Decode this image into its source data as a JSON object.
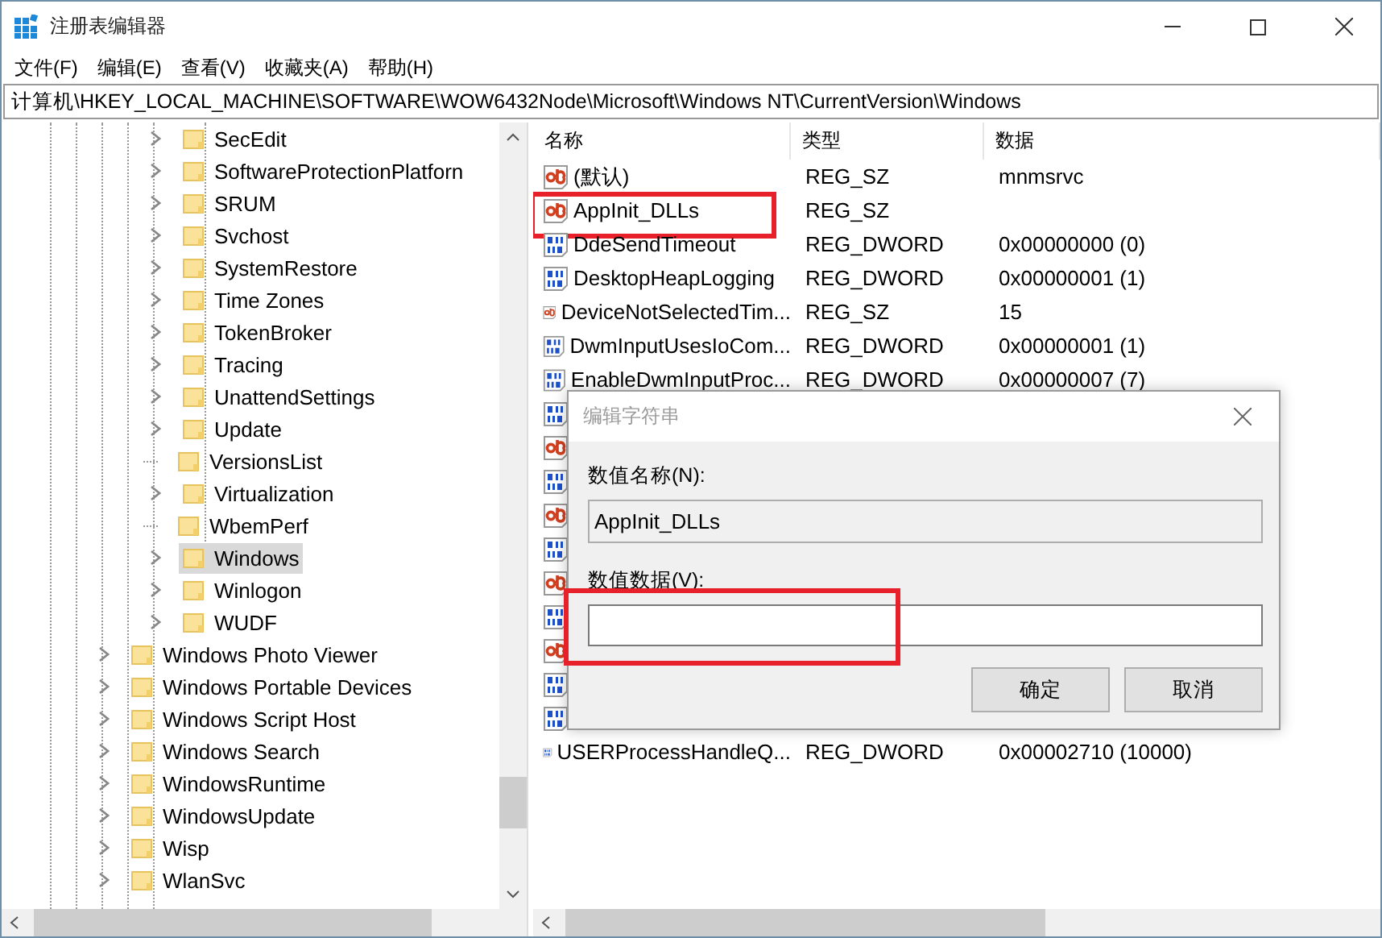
{
  "window": {
    "title": "注册表编辑器"
  },
  "menu": [
    "文件(F)",
    "编辑(E)",
    "查看(V)",
    "收藏夹(A)",
    "帮助(H)"
  ],
  "address": "计算机\\HKEY_LOCAL_MACHINE\\SOFTWARE\\WOW6432Node\\Microsoft\\Windows NT\\CurrentVersion\\Windows",
  "tree": {
    "items": [
      {
        "children": [
          {
            "name": "SecEdit",
            "expandable": true,
            "selected": false
          },
          {
            "name": "SoftwareProtectionPlatforn",
            "expandable": true,
            "selected": false
          },
          {
            "name": "SRUM",
            "expandable": true,
            "selected": false
          },
          {
            "name": "Svchost",
            "expandable": true,
            "selected": false
          },
          {
            "name": "SystemRestore",
            "expandable": true,
            "selected": false
          },
          {
            "name": "Time Zones",
            "expandable": true,
            "selected": false
          },
          {
            "name": "TokenBroker",
            "expandable": true,
            "selected": false
          },
          {
            "name": "Tracing",
            "expandable": true,
            "selected": false
          },
          {
            "name": "UnattendSettings",
            "expandable": true,
            "selected": false
          },
          {
            "name": "Update",
            "expandable": true,
            "selected": false
          },
          {
            "name": "VersionsList",
            "expandable": false,
            "selected": false
          },
          {
            "name": "Virtualization",
            "expandable": true,
            "selected": false
          },
          {
            "name": "WbemPerf",
            "expandable": false,
            "selected": false
          },
          {
            "name": "Windows",
            "expandable": true,
            "selected": true
          },
          {
            "name": "Winlogon",
            "expandable": true,
            "selected": false
          },
          {
            "name": "WUDF",
            "expandable": true,
            "selected": false
          }
        ]
      },
      {
        "name": "Windows Photo Viewer",
        "expandable": true,
        "selected": false
      },
      {
        "name": "Windows Portable Devices",
        "expandable": true,
        "selected": false
      },
      {
        "name": "Windows Script Host",
        "expandable": true,
        "selected": false
      },
      {
        "name": "Windows Search",
        "expandable": true,
        "selected": false
      },
      {
        "name": "WindowsRuntime",
        "expandable": true,
        "selected": false
      },
      {
        "name": "WindowsUpdate",
        "expandable": true,
        "selected": false
      },
      {
        "name": "Wisp",
        "expandable": true,
        "selected": false
      },
      {
        "name": "WlanSvc",
        "expandable": true,
        "selected": false
      }
    ]
  },
  "list": {
    "columns": [
      "名称",
      "类型",
      "数据"
    ],
    "rows": [
      {
        "kind": "string",
        "name": "(默认)",
        "type": "REG_SZ",
        "data": "mnmsrvc"
      },
      {
        "kind": "string",
        "name": "AppInit_DLLs",
        "type": "REG_SZ",
        "highlighted": true
      },
      {
        "kind": "dword",
        "name": "DdeSendTimeout",
        "type": "REG_DWORD",
        "data": "0x00000000 (0)"
      },
      {
        "kind": "dword",
        "name": "DesktopHeapLogging",
        "type": "REG_DWORD",
        "data": "0x00000001 (1)"
      },
      {
        "kind": "string",
        "name": "DeviceNotSelectedTim...",
        "type": "REG_SZ",
        "data": "15"
      },
      {
        "kind": "dword",
        "name": "DwmInputUsesIoCom...",
        "type": "REG_DWORD",
        "data": "0x00000001 (1)"
      },
      {
        "kind": "dword",
        "name": "EnableDwmInputProc...",
        "type": "REG_DWORD",
        "data": "0x00000007 (7)"
      },
      {
        "kind": "dword"
      },
      {
        "kind": "string"
      },
      {
        "kind": "dword"
      },
      {
        "kind": "string"
      },
      {
        "kind": "dword"
      },
      {
        "kind": "string"
      },
      {
        "kind": "dword"
      },
      {
        "kind": "string"
      },
      {
        "kind": "dword"
      },
      {
        "kind": "dword"
      },
      {
        "kind": "dword",
        "name": "USERProcessHandleQ...",
        "type": "REG_DWORD",
        "data": "0x00002710 (10000)"
      }
    ]
  },
  "dialog": {
    "title": "编辑字符串",
    "name_label": "数值名称(N):",
    "name_value": "AppInit_DLLs",
    "data_label": "数值数据(V):",
    "data_highlighted": true,
    "buttons": [
      "确定",
      "取消"
    ]
  }
}
